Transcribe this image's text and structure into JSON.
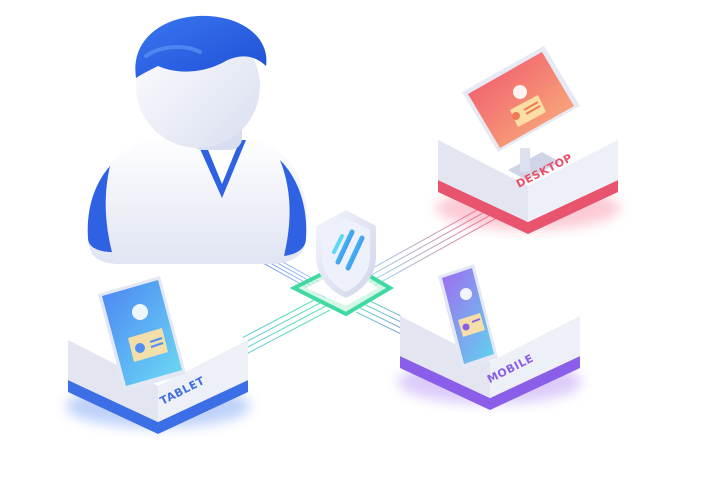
{
  "nodes": {
    "desktop": {
      "label": "DESKTOP"
    },
    "tablet": {
      "label": "TABLET"
    },
    "mobile": {
      "label": "MOBILE"
    }
  },
  "hub": {
    "icon": "shield-icon"
  },
  "user": {
    "icon": "user-avatar-icon"
  },
  "card_icon": "id-card-icon",
  "colors": {
    "desktop_grad": [
      "#f15d6f",
      "#f8b37a"
    ],
    "tablet_grad": [
      "#4e8ff5",
      "#68d9f5"
    ],
    "mobile_grad": [
      "#9d6cf0",
      "#62cfee"
    ],
    "user_blue": "#2f62e3",
    "hub_green": "#3fd9a1",
    "label_pink": "#e8506a",
    "label_blue": "#3f6fe0",
    "label_purple": "#8a5ee8"
  }
}
